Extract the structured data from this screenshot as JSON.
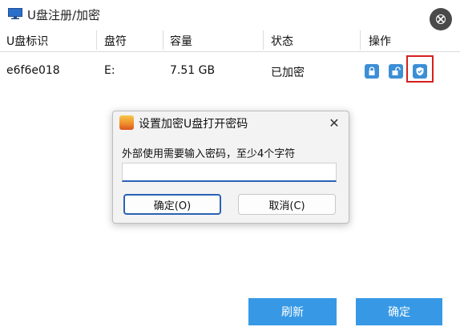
{
  "window": {
    "title": "U盘注册/加密",
    "help_label": "⎋"
  },
  "table": {
    "headers": [
      "U盘标识",
      "盘符",
      "容量",
      "状态",
      "操作"
    ],
    "rows": [
      {
        "id": "e6f6e018",
        "drive": "E:",
        "capacity": "7.51 GB",
        "status": "已加密"
      }
    ]
  },
  "operations": {
    "icons": [
      "lock-icon",
      "unlock-icon",
      "shield-check-icon"
    ],
    "accent": "#3c8fd6",
    "highlight": "#d62020"
  },
  "dialog": {
    "title": "设置加密U盘打开密码",
    "close_label": "✕",
    "prompt": "外部使用需要输入密码，至少4个字符",
    "input_value": "",
    "ok_label": "确定(O)",
    "cancel_label": "取消(C)"
  },
  "buttons": {
    "refresh_label": "刷新",
    "confirm_label": "确定",
    "color": "#3799e6"
  }
}
